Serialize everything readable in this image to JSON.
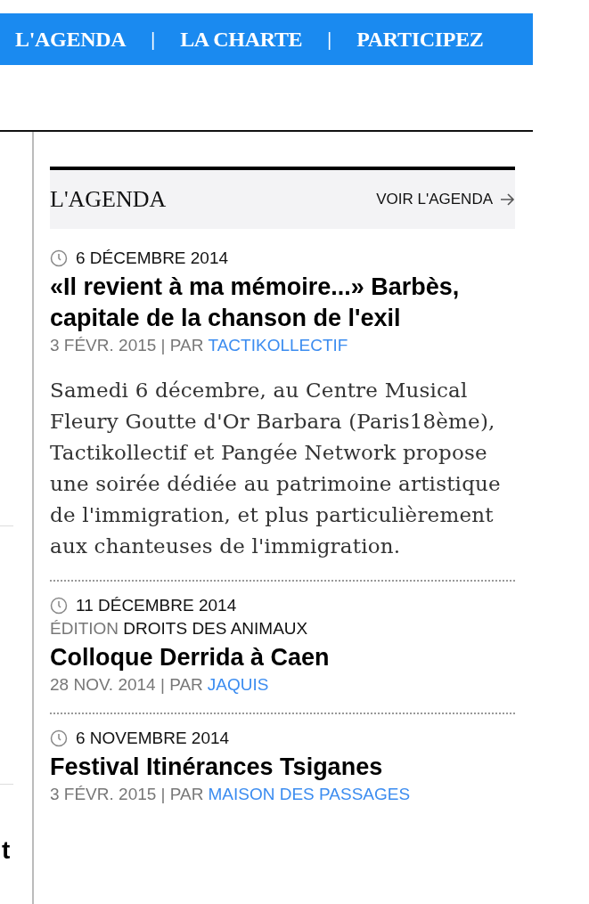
{
  "nav": [
    {
      "kind": "link",
      "label": "L'AGENDA"
    },
    {
      "kind": "separator",
      "label": "|"
    },
    {
      "kind": "link",
      "label": "LA CHARTE"
    },
    {
      "kind": "separator",
      "label": "|"
    },
    {
      "kind": "link",
      "label": "PARTICIPEZ"
    }
  ],
  "left_column": {
    "fragment": "t"
  },
  "agenda": {
    "title": "L'AGENDA",
    "link_label": "VOIR L'AGENDA",
    "events": [
      {
        "date": "6 DÉCEMBRE 2014",
        "title": "«Il revient à ma mémoire...» Barbès, capitale de la chanson de l'exil",
        "published": "3 FÉVR. 2015 | PAR",
        "author": "TACTIKOLLECTIF",
        "description": "Samedi 6 décembre, au Centre Musical Fleury Goutte d'Or Barbara (Paris18ème), Tactikollectif et Pangée Network propose une soirée dédiée au patrimoine artistique de l'immigration, et plus particulièrement aux chanteuses de l'immigration."
      },
      {
        "date": "11 DÉCEMBRE 2014",
        "edition_label": "ÉDITION",
        "edition_name": "DROITS DES ANIMAUX",
        "title": "Colloque Derrida à Caen",
        "published": "28 NOV. 2014 | PAR",
        "author": "JAQUIS"
      },
      {
        "date": "6 NOVEMBRE 2014",
        "title": "Festival Itinérances Tsiganes",
        "published": "3 FÉVR. 2015 | PAR",
        "author": "MAISON DES PASSAGES"
      }
    ]
  }
}
